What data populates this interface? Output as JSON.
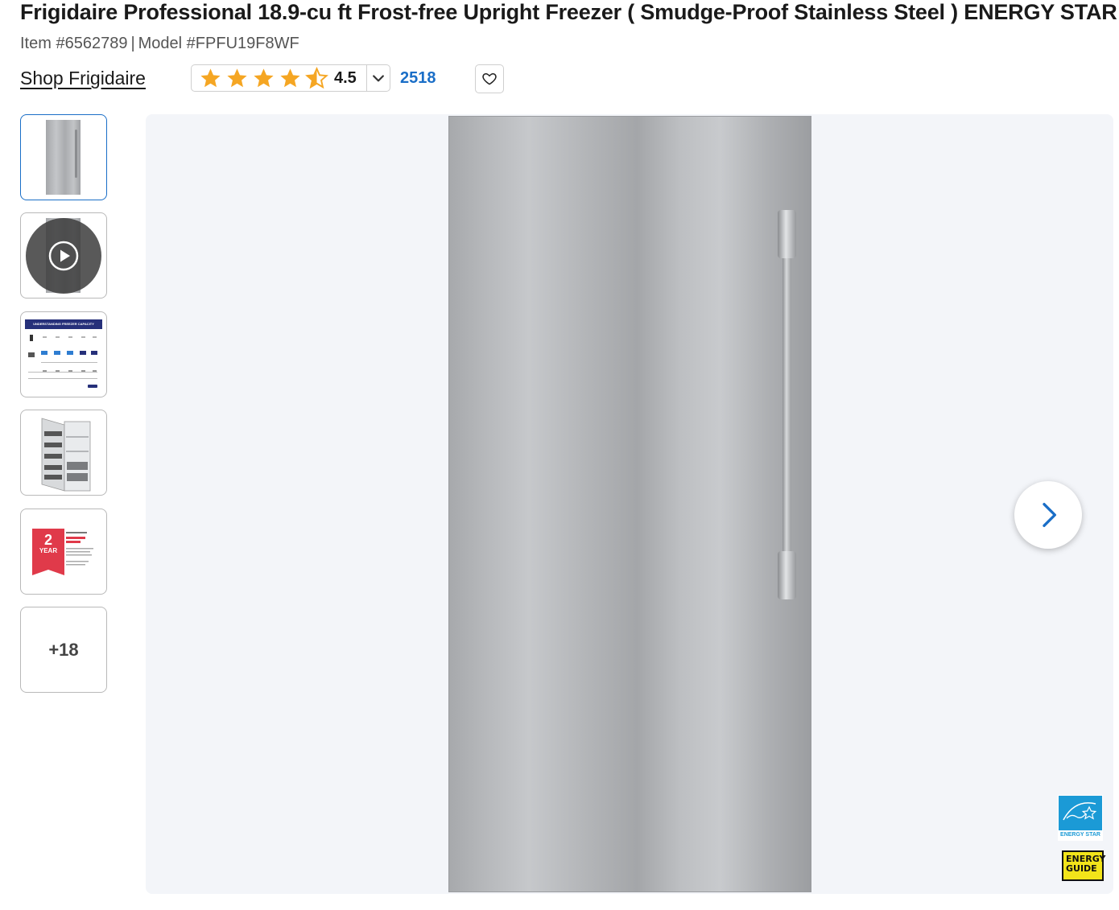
{
  "product": {
    "title": "Frigidaire Professional 18.9-cu ft Frost-free Upright Freezer ( Smudge-Proof Stainless Steel ) ENERGY STAR",
    "item_label": "Item #6562789",
    "separator": "|",
    "model_label": "Model #FPFU19F8WF",
    "shop_link": "Shop Frigidaire"
  },
  "rating": {
    "value": "4.5",
    "review_count": "2518",
    "stars": 4.5,
    "star_color": "#f5a623"
  },
  "gallery": {
    "thumbnails": [
      {
        "name": "freezer-front",
        "selected": true
      },
      {
        "name": "video",
        "selected": false
      },
      {
        "name": "capacity-chart",
        "selected": false
      },
      {
        "name": "freezer-open",
        "selected": false
      },
      {
        "name": "warranty",
        "selected": false
      }
    ],
    "more_label": "+18",
    "warranty_number": "2",
    "warranty_word": "YEAR",
    "capacity_header": "UNDERSTANDING FREEZER CAPACITY"
  },
  "badges": {
    "energy_star_label": "ENERGY STAR",
    "energy_guide_line1": "ENERGY",
    "energy_guide_line2": "GUIDE"
  },
  "colors": {
    "accent": "#1a6ec7",
    "background": "#f3f5f9"
  }
}
